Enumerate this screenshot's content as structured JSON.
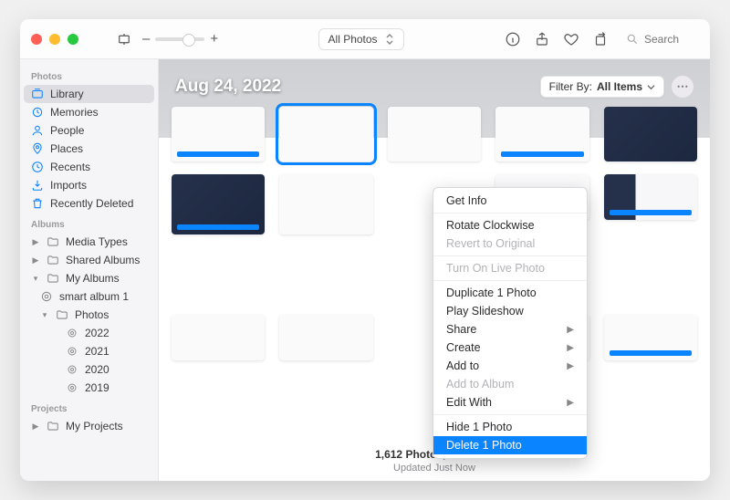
{
  "toolbar": {
    "zoom_minus": "–",
    "zoom_plus": "+",
    "view_select_label": "All Photos",
    "search_placeholder": "Search"
  },
  "sidebar": {
    "sections": [
      {
        "header": "Photos",
        "items": [
          {
            "label": "Library",
            "selected": true,
            "icon": "library"
          },
          {
            "label": "Memories",
            "icon": "memories"
          },
          {
            "label": "People",
            "icon": "people"
          },
          {
            "label": "Places",
            "icon": "places"
          },
          {
            "label": "Recents",
            "icon": "recents"
          },
          {
            "label": "Imports",
            "icon": "imports"
          },
          {
            "label": "Recently Deleted",
            "icon": "trash"
          }
        ]
      },
      {
        "header": "Albums",
        "items": [
          {
            "label": "Media Types",
            "disc": "closed",
            "icon": "folder"
          },
          {
            "label": "Shared Albums",
            "disc": "closed",
            "icon": "folder"
          },
          {
            "label": "My Albums",
            "disc": "open",
            "icon": "folder",
            "children": [
              {
                "label": "smart album 1",
                "icon": "smart"
              },
              {
                "label": "Photos",
                "disc": "open",
                "icon": "folder",
                "children": [
                  {
                    "label": "2022",
                    "icon": "smart"
                  },
                  {
                    "label": "2021",
                    "icon": "smart"
                  },
                  {
                    "label": "2020",
                    "icon": "smart"
                  },
                  {
                    "label": "2019",
                    "icon": "smart"
                  }
                ]
              }
            ]
          }
        ]
      },
      {
        "header": "Projects",
        "items": [
          {
            "label": "My Projects",
            "disc": "closed",
            "icon": "folder"
          }
        ]
      }
    ]
  },
  "main": {
    "date_header": "Aug 24, 2022",
    "filter_prefix": "Filter By:",
    "filter_value": "All Items",
    "footer_main": "1,612 Photos, 7 Videos",
    "footer_sub": "Updated Just Now"
  },
  "context_menu": [
    {
      "label": "Get Info"
    },
    {
      "sep": true
    },
    {
      "label": "Rotate Clockwise"
    },
    {
      "label": "Revert to Original",
      "disabled": true
    },
    {
      "sep": true
    },
    {
      "label": "Turn On Live Photo",
      "disabled": true
    },
    {
      "sep": true
    },
    {
      "label": "Duplicate 1 Photo"
    },
    {
      "label": "Play Slideshow"
    },
    {
      "label": "Share",
      "submenu": true
    },
    {
      "label": "Create",
      "submenu": true
    },
    {
      "label": "Add to",
      "submenu": true
    },
    {
      "label": "Add to Album",
      "disabled": true
    },
    {
      "label": "Edit With",
      "submenu": true
    },
    {
      "sep": true
    },
    {
      "label": "Hide 1 Photo"
    },
    {
      "label": "Delete 1 Photo",
      "selected": true
    }
  ]
}
